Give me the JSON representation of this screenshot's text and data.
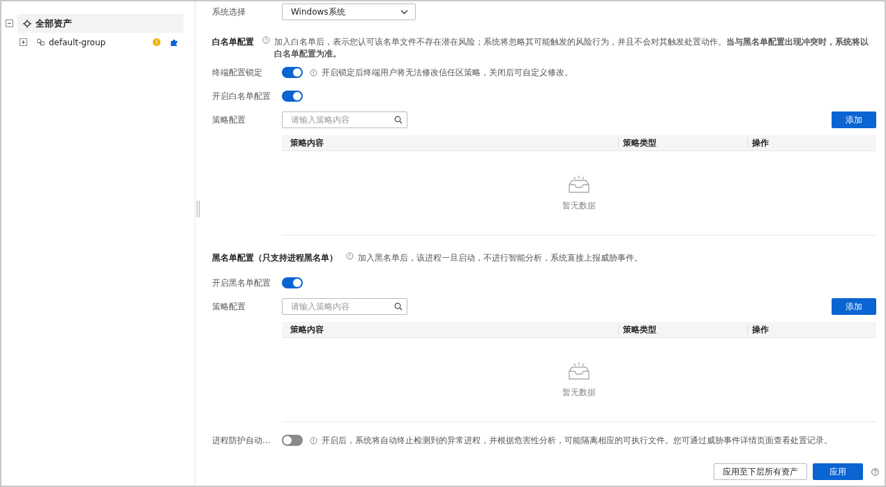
{
  "tree": [
    {
      "label": "全部资产",
      "expanded": true,
      "selected": true,
      "children": [
        {
          "label": "default-group",
          "expanded": false,
          "selected": false,
          "warning": true,
          "plugin": true
        }
      ]
    }
  ],
  "system_select": {
    "label": "系统选择",
    "value": "Windows系统"
  },
  "whitelist": {
    "title": "白名单配置",
    "description": "加入白名单后，表示您认可该名单文件不存在潜在风险；系统将忽略其可能触发的风险行为，并且不会对其触发处置动作。**当与黑名单配置出现冲突时，系统将以白名单配置为准。**",
    "switches": [
      {
        "label": "终端配置锁定",
        "on": true,
        "hint": "开启锁定后终端用户将无法修改信任区策略，关闭后可自定义修改。"
      },
      {
        "label": "开启白名单配置",
        "on": true
      }
    ],
    "policy": {
      "label": "策略配置",
      "placeholder": "请输入策略内容",
      "add_button": "添加",
      "columns": [
        "策略内容",
        "策略类型",
        "操作"
      ],
      "empty_text": "暂无数据"
    }
  },
  "blacklist": {
    "title": "黑名单配置（只支持进程黑名单）",
    "description": "加入黑名单后，该进程一旦启动，不进行智能分析，系统直接上报威胁事件。",
    "switches": [
      {
        "label": "开启黑名单配置",
        "on": true
      }
    ],
    "policy": {
      "label": "策略配置",
      "placeholder": "请输入策略内容",
      "add_button": "添加",
      "columns": [
        "策略内容",
        "策略类型",
        "操作"
      ],
      "empty_text": "暂无数据"
    }
  },
  "process_protection": {
    "label": "进程防护自动...",
    "on": false,
    "hint": "开启后，系统将自动终止检测到的异常进程，并根据危害性分析，可能隔离相应的可执行文件。您可通过威胁事件详情页面查看处置记录。"
  },
  "footer": {
    "apply_all_button": "应用至下层所有资产",
    "apply_button": "应用"
  }
}
